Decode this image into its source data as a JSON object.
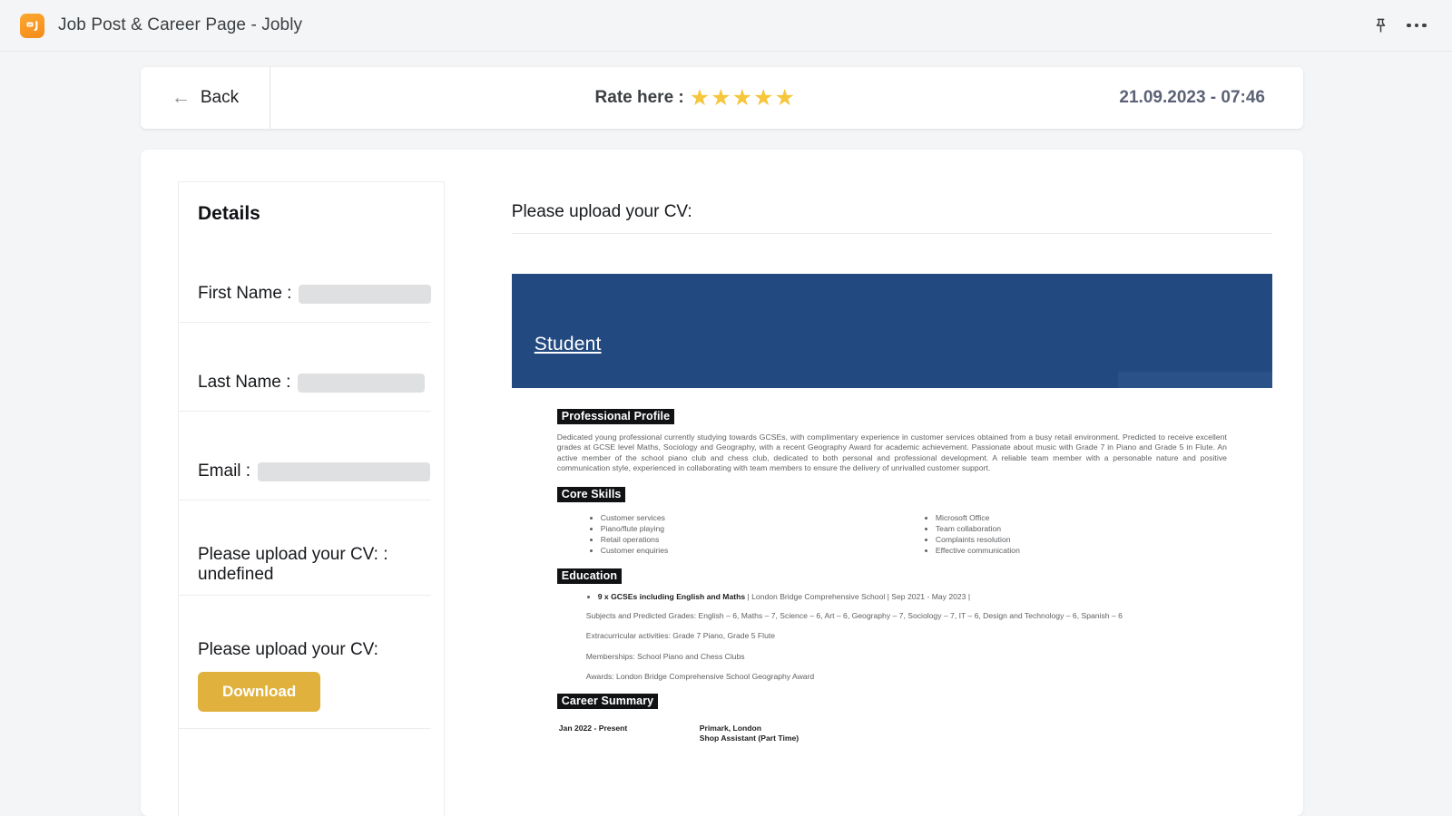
{
  "topbar": {
    "logo_icon": "jobly-logo-icon",
    "title": "Job Post & Career Page - Jobly",
    "pin_icon": "pin-icon",
    "more_icon": "more-options-icon"
  },
  "header": {
    "back_label": "Back",
    "back_icon": "arrow-left-icon",
    "rate_label": "Rate here :",
    "stars": [
      "★",
      "★",
      "★",
      "★",
      "★"
    ],
    "star_filled_count": 5,
    "star_color": "#f6c63c",
    "datetime": "21.09.2023 - 07:46"
  },
  "details": {
    "title": "Details",
    "fields": [
      {
        "label": "First Name :",
        "value": ""
      },
      {
        "label": "Last Name :",
        "value": ""
      },
      {
        "label": "Email :",
        "value": ""
      }
    ],
    "cv_text_row": "Please upload your CV: : undefined",
    "upload_label": "Please upload your CV:",
    "download_button": "Download",
    "download_button_color": "#e0b13c"
  },
  "preview": {
    "upload_label": "Please upload your CV:",
    "banner_color": "#234a80",
    "banner_name": "Student"
  },
  "cv": {
    "sections": {
      "profile_heading": "Professional Profile",
      "profile_text": "Dedicated young professional currently studying towards GCSEs, with complimentary experience in customer services obtained from a busy retail environment. Predicted to receive excellent grades at GCSE level Maths, Sociology and Geography, with a recent Geography Award for academic achievement. Passionate about music with Grade 7 in Piano and Grade 5 in Flute. An active member of the school piano club and chess club, dedicated to both personal and professional development. A reliable team member with a personable nature and positive communication style, experienced in collaborating with team members to ensure the delivery of unrivalled customer support.",
      "skills_heading": "Core Skills",
      "skills_left": [
        "Customer services",
        "Piano/flute playing",
        "Retail operations",
        "Customer enquiries"
      ],
      "skills_right": [
        "Microsoft Office",
        "Team collaboration",
        "Complaints resolution",
        "Effective communication"
      ],
      "education_heading": "Education",
      "education_item_bold": "9 x GCSEs including English and Maths",
      "education_item_rest": " | London Bridge Comprehensive School | Sep 2021 - May 2023 |",
      "education_notes": [
        "Subjects and Predicted Grades: English – 6, Maths – 7, Science – 6, Art – 6, Geography – 7, Sociology – 7, IT – 6, Design and Technology – 6, Spanish – 6",
        "Extracurricular activities: Grade 7 Piano, Grade 5 Flute",
        "Memberships: School Piano and Chess Clubs",
        "Awards: London Bridge Comprehensive School Geography Award"
      ],
      "career_heading": "Career Summary",
      "career_date": "Jan 2022 - Present",
      "career_company": "Primark, London",
      "career_role": "Shop Assistant (Part Time)"
    }
  }
}
